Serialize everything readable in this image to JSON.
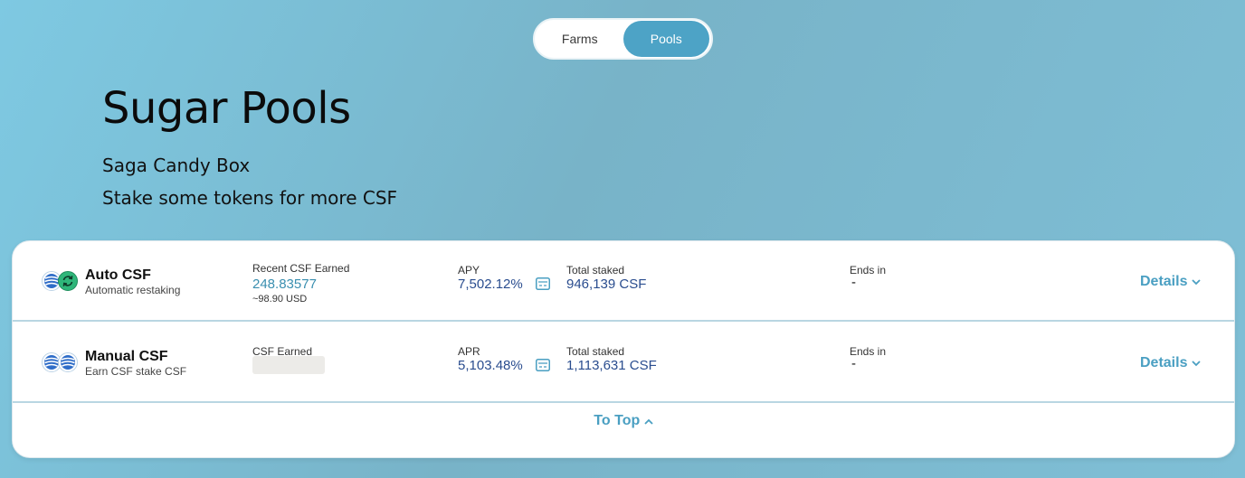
{
  "toggle": {
    "farms_label": "Farms",
    "pools_label": "Pools",
    "active": "Pools"
  },
  "hero": {
    "title": "Sugar Pools",
    "subtitle1": "Saga Candy Box",
    "subtitle2": "Stake some tokens for more CSF"
  },
  "pools": [
    {
      "name": "Auto CSF",
      "desc": "Automatic restaking",
      "earned_label": "Recent CSF Earned",
      "earned_value": "248.83577",
      "earned_usd": "~98.90 USD",
      "rate_label": "APY",
      "rate_value": "7,502.12%",
      "staked_label": "Total staked",
      "staked_value": "946,139 CSF",
      "ends_label": "Ends in",
      "ends_value": "-",
      "details_label": "Details",
      "icons": [
        "csf-token-icon",
        "auto-restake-icon"
      ]
    },
    {
      "name": "Manual CSF",
      "desc": "Earn CSF stake CSF",
      "earned_label": "CSF Earned",
      "rate_label": "APR",
      "rate_value": "5,103.48%",
      "staked_label": "Total staked",
      "staked_value": "1,113,631 CSF",
      "ends_label": "Ends in",
      "ends_value": "-",
      "details_label": "Details",
      "icons": [
        "csf-token-icon",
        "csf-token-icon"
      ]
    }
  ],
  "footer": {
    "to_top_label": "To Top"
  },
  "colors": {
    "accent": "#4a9fc2",
    "value_blue": "#2a4d8f",
    "toggle_active": "#4da3c6"
  }
}
